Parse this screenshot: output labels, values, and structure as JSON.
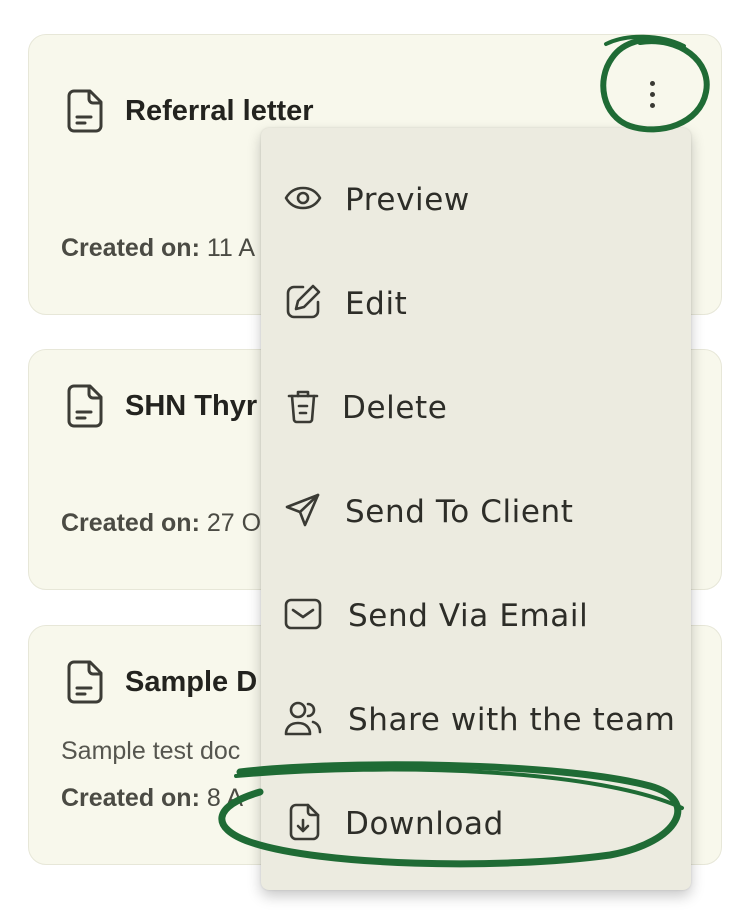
{
  "cards": [
    {
      "title": "Referral letter",
      "created_label": "Created on:",
      "created_value": "11 A",
      "description": ""
    },
    {
      "title": "SHN Thyr",
      "created_label": "Created on:",
      "created_value": "27 O",
      "description": ""
    },
    {
      "title": "Sample D",
      "created_label": "Created on:",
      "created_value": "8 A",
      "description": "Sample test doc"
    }
  ],
  "menu": {
    "items": [
      {
        "label": "Preview",
        "icon": "eye-icon"
      },
      {
        "label": "Edit",
        "icon": "edit-icon"
      },
      {
        "label": "Delete",
        "icon": "trash-icon"
      },
      {
        "label": "Send To Client",
        "icon": "send-icon"
      },
      {
        "label": "Send Via Email",
        "icon": "mail-icon"
      },
      {
        "label": "Share with the team",
        "icon": "users-icon"
      },
      {
        "label": "Download",
        "icon": "download-icon"
      }
    ]
  },
  "colors": {
    "card_background": "#f8f8ec",
    "menu_background": "#ecebe0",
    "annotation": "#1f6b35"
  }
}
